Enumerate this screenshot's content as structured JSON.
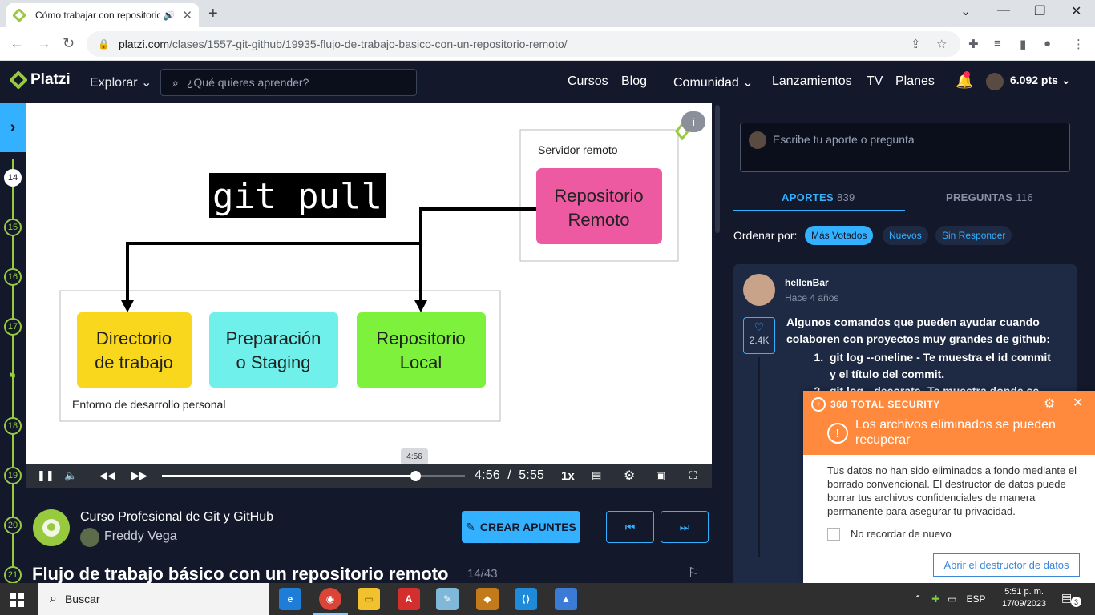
{
  "browser": {
    "tab_title": "Cómo trabajar con repositorios",
    "url_host": "platzi.com",
    "url_path": "/clases/1557-git-github/19935-flujo-de-trabajo-basico-con-un-repositorio-remoto/"
  },
  "header": {
    "logo": "Platzi",
    "explore": "Explorar",
    "search_placeholder": "¿Qué quieres aprender?",
    "nav": [
      "Cursos",
      "Blog",
      "Comunidad",
      "Lanzamientos",
      "TV",
      "Planes"
    ],
    "points": "6.092 pts"
  },
  "rail": {
    "items": [
      "14",
      "15",
      "16",
      "17",
      "18",
      "19",
      "20",
      "21"
    ],
    "current": "14"
  },
  "slide": {
    "command": "git pull",
    "server_label": "Servidor remoto",
    "remote_repo": [
      "Repositorio",
      "Remoto"
    ],
    "workdir": [
      "Directorio",
      "de trabajo"
    ],
    "staging": [
      "Preparación",
      "o Staging"
    ],
    "local_repo": [
      "Repositorio",
      "Local"
    ],
    "env_label": "Entorno de desarrollo personal",
    "colors": {
      "workdir": "#f9d71c",
      "staging": "#6ff0ea",
      "local": "#7ef13d",
      "remote": "#ee5aa1"
    }
  },
  "player": {
    "tooltip": "4:56",
    "current_time": "4:56",
    "separator": "/",
    "duration": "5:55",
    "speed": "1x",
    "progress_fraction": 0.835
  },
  "course": {
    "title": "Curso Profesional de Git y GitHub",
    "teacher": "Freddy Vega",
    "notes_button": "CREAR APUNTES",
    "lesson_title": "Flujo de trabajo básico con un repositorio remoto",
    "lesson_count": "14/43"
  },
  "panel": {
    "compose_placeholder": "Escribe tu aporte o pregunta",
    "tabs": [
      {
        "label": "APORTES",
        "count": "839"
      },
      {
        "label": "PREGUNTAS",
        "count": "116"
      }
    ],
    "order_label": "Ordenar por:",
    "chips": [
      "Más Votados",
      "Nuevos",
      "Sin Responder"
    ],
    "post": {
      "user": "hellenBar",
      "time": "Hace 4 años",
      "likes": "2.4K",
      "intro": "Algunos comandos que pueden ayudar cuando colaboren con proyectos muy grandes de github:",
      "items": [
        "git log --oneline - Te muestra el id commit y el título del commit.",
        "git log --decorate- Te muestra donde se"
      ]
    }
  },
  "popup": {
    "brand": "360 TOTAL SECURITY",
    "title": "Los archivos eliminados se pueden recuperar",
    "body": "Tus datos no han sido eliminados a fondo mediante el borrado convencional. El destructor de datos puede borrar tus archivos confidenciales de manera permanente para asegurar tu privacidad.",
    "checkbox": "No recordar de nuevo",
    "action": "Abrir el destructor de datos"
  },
  "taskbar": {
    "search": "Buscar",
    "lang": "ESP",
    "time": "5:51 p. m.",
    "date": "17/09/2023",
    "notifications": "3"
  }
}
